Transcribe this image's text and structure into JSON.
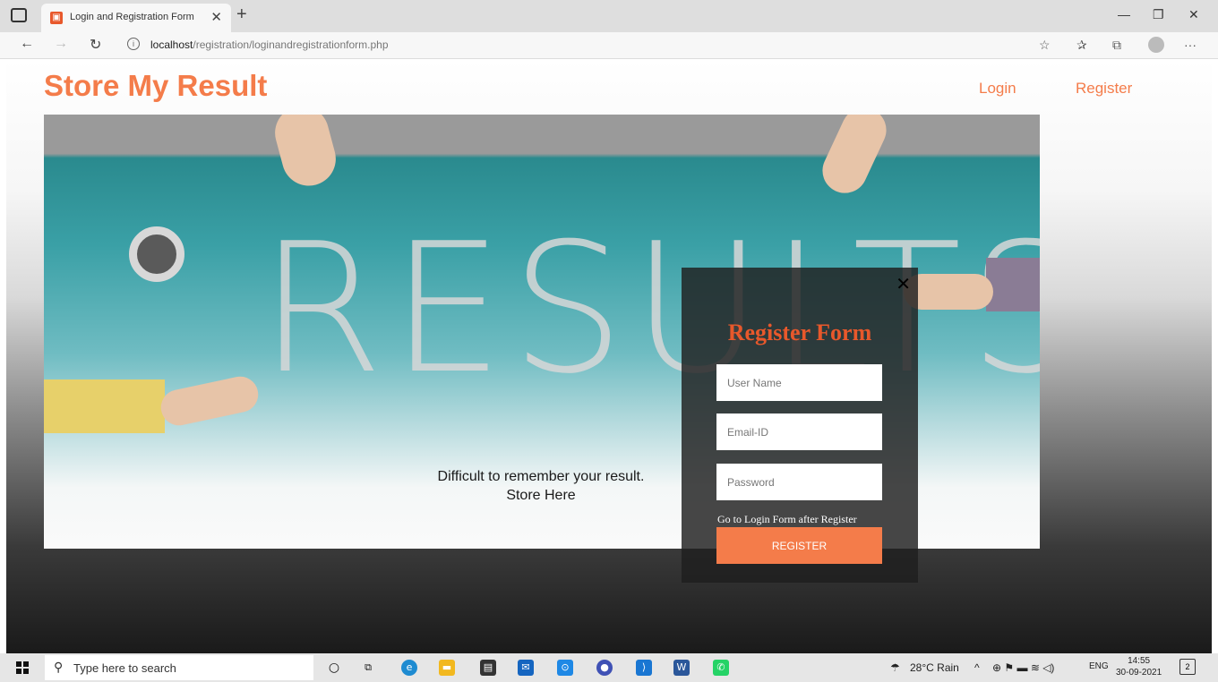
{
  "browser": {
    "tab_title": "Login and Registration Form",
    "url_host": "localhost",
    "url_path": "/registration/loginandregistrationform.php"
  },
  "header": {
    "brand": "Store My Result",
    "nav": {
      "login": "Login",
      "register": "Register"
    }
  },
  "hero": {
    "caption_line1": "Difficult to remember your result.",
    "caption_line2": "Store Here",
    "word": "RESULTS"
  },
  "register_form": {
    "title": "Register Form",
    "username_placeholder": "User Name",
    "email_placeholder": "Email-ID",
    "password_placeholder": "Password",
    "login_note": "Go to Login Form after Register",
    "submit_label": "REGISTER"
  },
  "taskbar": {
    "search_placeholder": "Type here to search",
    "weather": "28°C  Rain",
    "language": "ENG",
    "time": "14:55",
    "date": "30-09-2021"
  },
  "colors": {
    "brand": "#f47c4a",
    "title": "#e8582b"
  }
}
